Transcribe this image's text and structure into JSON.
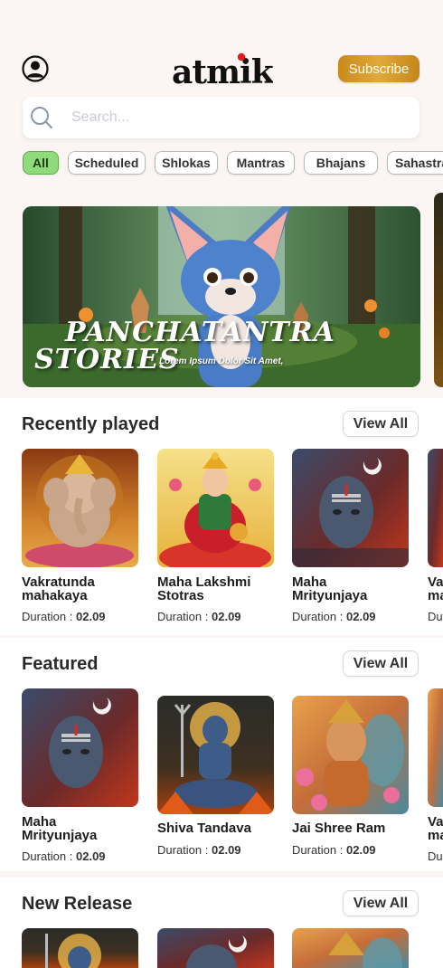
{
  "header": {
    "logo_text": "atmik",
    "subscribe_label": "Subscribe",
    "profile_icon": "user-circle-icon"
  },
  "search": {
    "placeholder": "Search...",
    "value": ""
  },
  "filters": [
    {
      "label": "All",
      "active": true
    },
    {
      "label": "Scheduled",
      "active": false
    },
    {
      "label": "Shlokas",
      "active": false
    },
    {
      "label": "Mantras",
      "active": false
    },
    {
      "label": "Bhajans",
      "active": false
    },
    {
      "label": "Sahastra",
      "active": false
    }
  ],
  "banner": {
    "title_line1": "PANCHATANTRA",
    "title_line2": "STORIES",
    "subtitle": "Lorem Ipsum Dolor Sit Amet,"
  },
  "sections": [
    {
      "title": "Recently  played",
      "view_all": "View All",
      "cards": [
        {
          "title_line1": "Vakratunda",
          "title_line2": "mahakaya",
          "duration_label": "Duration :",
          "duration": "02.09",
          "art": "ganesha"
        },
        {
          "title_line1": "Maha Lakshmi",
          "title_line2": "Stotras",
          "duration_label": "Duration :",
          "duration": "02.09",
          "art": "lakshmi"
        },
        {
          "title_line1": "Maha",
          "title_line2": "Mrityunjaya",
          "duration_label": "Duration :",
          "duration": "02.09",
          "art": "shiva-face"
        },
        {
          "title_line1": "Va",
          "title_line2": "ma",
          "duration_label": "Du",
          "duration": "",
          "art": "partial"
        }
      ]
    },
    {
      "title": "Featured",
      "view_all": "View All",
      "cards": [
        {
          "title_line1": "Maha",
          "title_line2": "Mrityunjaya",
          "duration_label": "Duration :",
          "duration": "02.09",
          "art": "shiva-face"
        },
        {
          "title_line1": "Shiva Tandava",
          "title_line2": "",
          "duration_label": "Duration :",
          "duration": "02.09",
          "art": "shiva-meditate"
        },
        {
          "title_line1": "Jai Shree Ram",
          "title_line2": "",
          "duration_label": "Duration :",
          "duration": "02.09",
          "art": "ram"
        },
        {
          "title_line1": "Va",
          "title_line2": "ma",
          "duration_label": "Du",
          "duration": "",
          "art": "partial"
        }
      ]
    },
    {
      "title": "New Release",
      "view_all": "View All",
      "cards": [
        {
          "art": "shiva-meditate"
        },
        {
          "art": "shiva-face"
        },
        {
          "art": "ram"
        }
      ]
    }
  ],
  "colors": {
    "accent_gold": "#d59a27",
    "chip_active": "#8fdb7b",
    "background": "#fbf6f3"
  }
}
